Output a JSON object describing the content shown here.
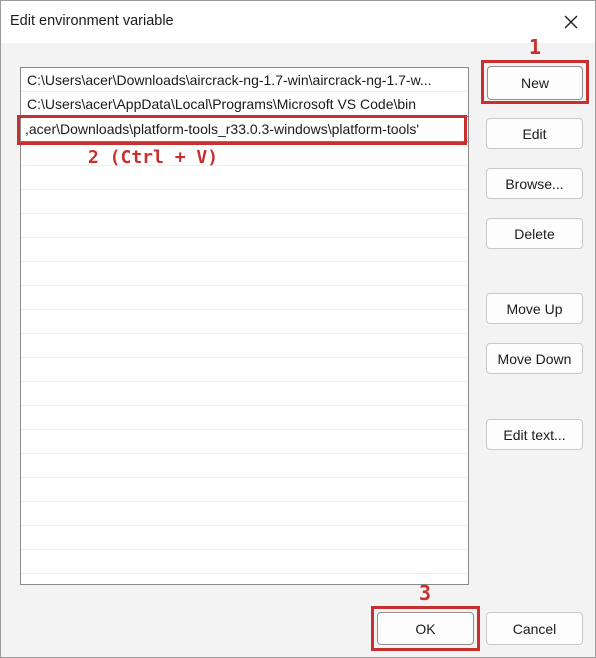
{
  "dialog": {
    "title": "Edit environment variable"
  },
  "list": {
    "items": [
      "C:\\Users\\acer\\Downloads\\aircrack-ng-1.7-win\\aircrack-ng-1.7-w...",
      "C:\\Users\\acer\\AppData\\Local\\Programs\\Microsoft VS Code\\bin",
      ",acer\\Downloads\\platform-tools_r33.0.3-windows\\platform-tools'"
    ]
  },
  "buttons": {
    "new": "New",
    "edit": "Edit",
    "browse": "Browse...",
    "delete": "Delete",
    "move_up": "Move Up",
    "move_down": "Move Down",
    "edit_text": "Edit text...",
    "ok": "OK",
    "cancel": "Cancel"
  },
  "annotations": {
    "step1": "1",
    "step2": "2 (Ctrl + V)",
    "step3": "3",
    "color": "#c8302f"
  }
}
